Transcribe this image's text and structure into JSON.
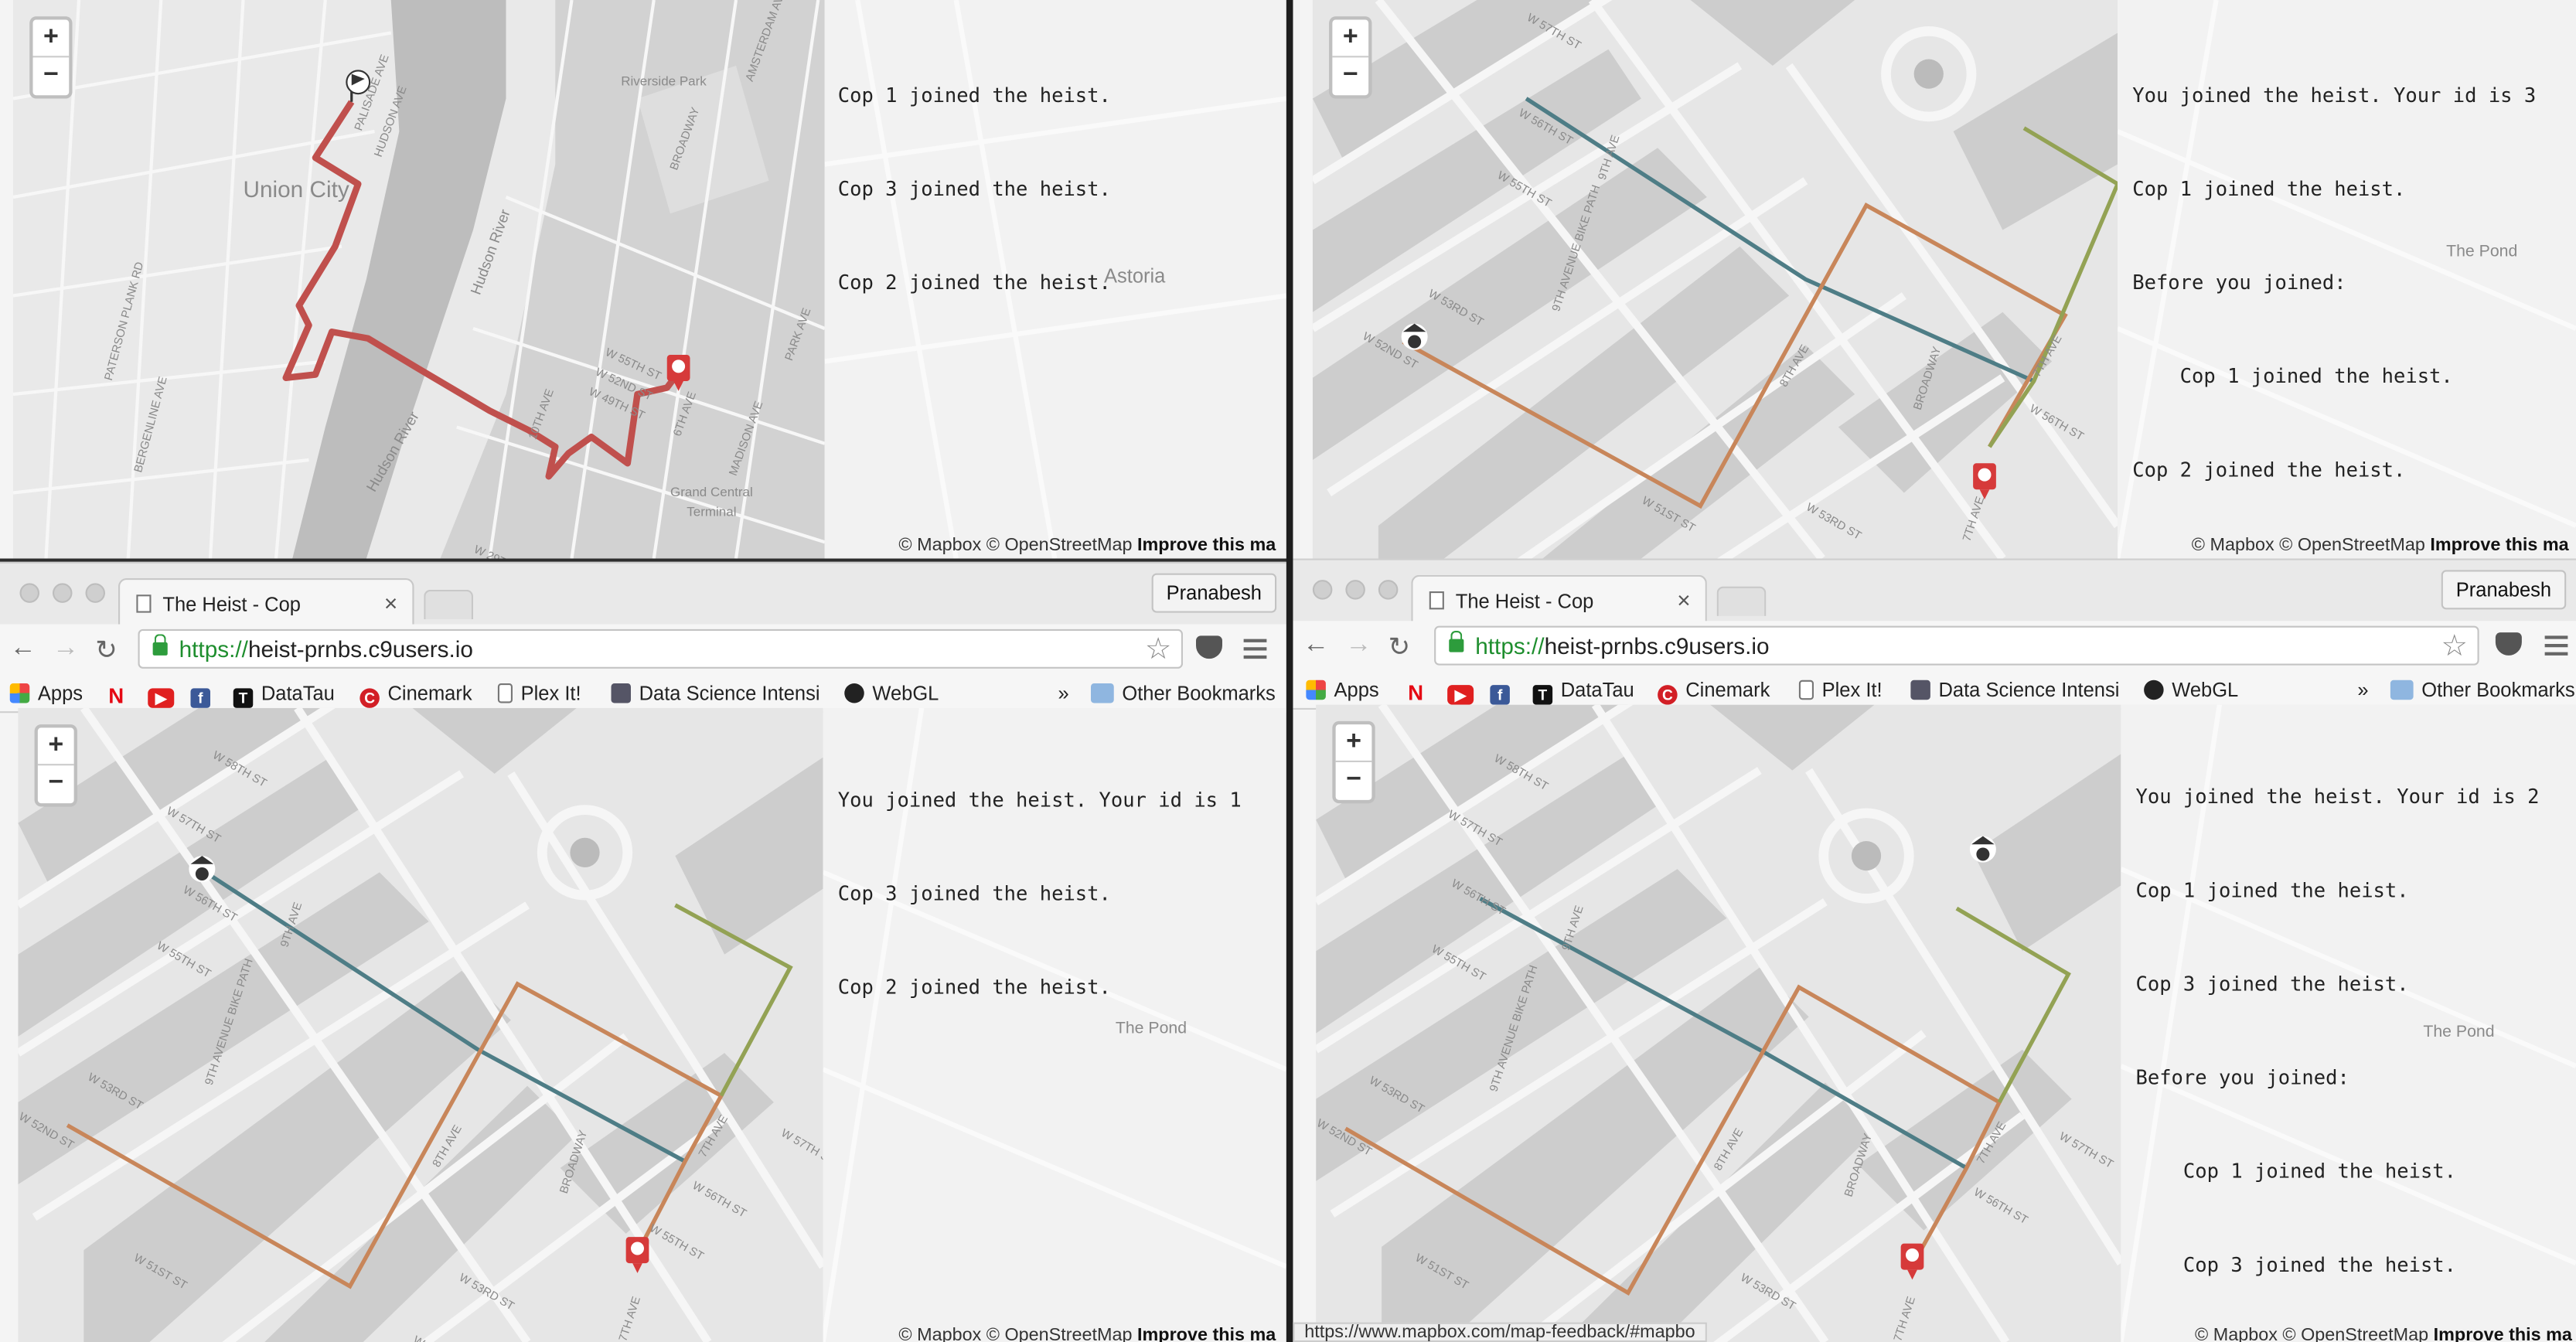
{
  "panes": [
    {
      "log": [
        "Cop 1 joined the heist.",
        "Cop 3 joined the heist.",
        "Cop 2 joined the heist."
      ],
      "map_labels": [
        "Union City",
        "Hudson River",
        "Hudson River",
        "Riverside Park",
        "Astoria",
        "Grand Central Terminal",
        "BERGENLINE AVE",
        "PATERSON PLANK RD",
        "BROADWAY",
        "AMSTERDAM AVE",
        "PARK AVE",
        "MADISON AVE",
        "6TH AVE",
        "W 55TH ST",
        "W 52ND ST",
        "W 49TH ST",
        "10TH AVE",
        "W 29TH ST",
        "HUDSON AVE",
        "PALISADE AVE"
      ]
    },
    {
      "log": [
        "You joined the heist. Your id is 3",
        "Cop 1 joined the heist.",
        "Before you joined:",
        "    Cop 1 joined the heist.",
        "Cop 2 joined the heist."
      ],
      "map_labels": [
        "W 57TH ST",
        "W 56TH ST",
        "W 55TH ST",
        "W 53RD ST",
        "W 52ND ST",
        "W 51ST ST",
        "W 53RD ST",
        "9TH AVENUE BIKE PATH",
        "9TH AVE",
        "BROADWAY",
        "W 56TH ST",
        "7TH AVE",
        "The Pond",
        "8TH AVE",
        "7TH AVE"
      ]
    },
    {
      "log": [
        "You joined the heist. Your id is 1",
        "Cop 3 joined the heist.",
        "Cop 2 joined the heist."
      ],
      "map_labels": [
        "W 58TH ST",
        "W 57TH ST",
        "W 56TH ST",
        "W 55TH ST",
        "W 53RD ST",
        "W 52ND ST",
        "W 51ST ST",
        "W 53RD ST",
        "W 52ND ST",
        "9TH AVENUE BIKE PATH",
        "9TH AVE",
        "BROADWAY",
        "W 56TH ST",
        "W 57TH ST",
        "7TH AVE",
        "The Pond",
        "8TH AVE",
        "7TH AVE",
        "W 55TH ST"
      ]
    },
    {
      "log": [
        "You joined the heist. Your id is 2",
        "Cop 1 joined the heist.",
        "Cop 3 joined the heist.",
        "Before you joined:",
        "    Cop 1 joined the heist.",
        "    Cop 3 joined the heist."
      ],
      "map_labels": [
        "W 58TH ST",
        "W 57TH ST",
        "W 56TH ST",
        "W 55TH ST",
        "W 53RD ST",
        "W 52ND ST",
        "W 51ST ST",
        "W 53RD ST",
        "9TH AVENUE BIKE PATH",
        "9TH AVE",
        "BROADWAY",
        "W 56TH ST",
        "W 57TH ST",
        "7TH AVE",
        "The Pond",
        "8TH AVE",
        "7TH AVE"
      ]
    }
  ],
  "map": {
    "zoom_in": "+",
    "zoom_out": "−",
    "attr_mapbox": "© Mapbox",
    "attr_osm": "© OpenStreetMap",
    "attr_improve": "Improve this ma"
  },
  "browser": {
    "tab_title": "The Heist - Cop",
    "tab_close": "×",
    "profile": "Pranabesh",
    "url_scheme": "https://",
    "url_host": "heist-prnbs.c9users.io",
    "back": "←",
    "forward": "→",
    "reload": "↻",
    "star": "☆",
    "bookmarks": [
      "Apps",
      "DataTau",
      "Cinemark",
      "Plex It!",
      "Data Science Intensi",
      "WebGL"
    ],
    "bookmarks_more": "»",
    "other_bookmarks": "Other Bookmarks"
  },
  "status_url": "https://www.mapbox.com/map-feedback/#mapbo",
  "colors": {
    "route_red": "#c0504d",
    "route_teal": "#4e7d86",
    "route_orange": "#c8865a",
    "route_olive": "#93a254",
    "robber_marker": "#d63a3a"
  }
}
